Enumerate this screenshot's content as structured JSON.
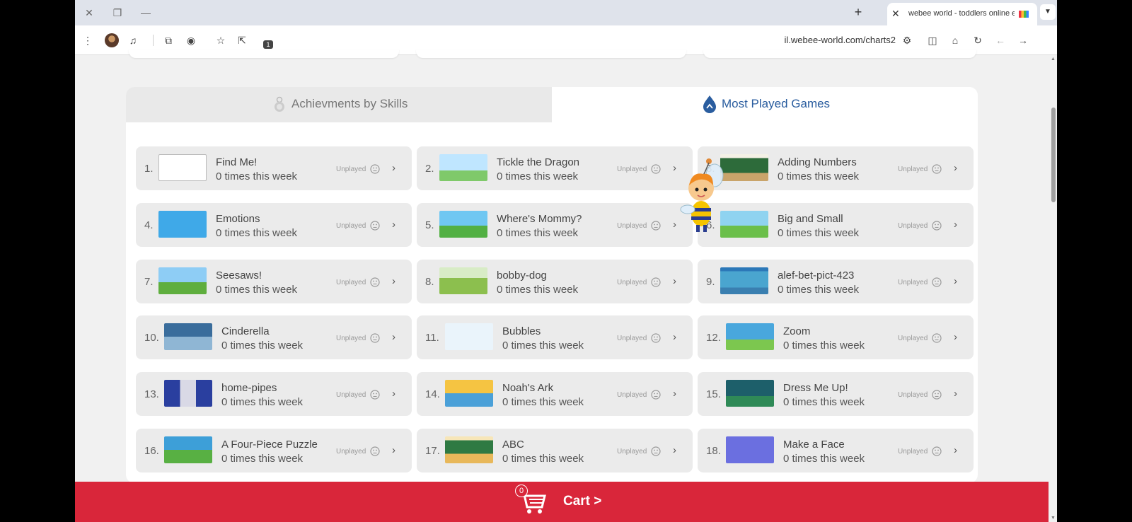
{
  "browser": {
    "tab_title": "webee world - toddlers online e",
    "url": "il.webee-world.com/charts2",
    "extensions_badge": "1"
  },
  "tabs": {
    "skills_label": "Achievments by Skills",
    "played_label": "Most Played Games"
  },
  "games": [
    {
      "rank": "1.",
      "name": "Find Me!",
      "times": "0 times this week",
      "status": "Unplayed"
    },
    {
      "rank": "2.",
      "name": "Tickle the Dragon",
      "times": "0 times this week",
      "status": "Unplayed"
    },
    {
      "rank": "3.",
      "name": "Adding Numbers",
      "times": "0 times this week",
      "status": "Unplayed"
    },
    {
      "rank": "4.",
      "name": "Emotions",
      "times": "0 times this week",
      "status": "Unplayed"
    },
    {
      "rank": "5.",
      "name": "Where's Mommy?",
      "times": "0 times this week",
      "status": "Unplayed"
    },
    {
      "rank": "6.",
      "name": "Big and Small",
      "times": "0 times this week",
      "status": "Unplayed"
    },
    {
      "rank": "7.",
      "name": "Seesaws!",
      "times": "0 times this week",
      "status": "Unplayed"
    },
    {
      "rank": "8.",
      "name": "bobby-dog",
      "times": "0 times this week",
      "status": "Unplayed"
    },
    {
      "rank": "9.",
      "name": "alef-bet-pict-423",
      "times": "0 times this week",
      "status": "Unplayed"
    },
    {
      "rank": "10.",
      "name": "Cinderella",
      "times": "0 times this week",
      "status": "Unplayed"
    },
    {
      "rank": "11.",
      "name": "Bubbles",
      "times": "0 times this week",
      "status": "Unplayed"
    },
    {
      "rank": "12.",
      "name": "Zoom",
      "times": "0 times this week",
      "status": "Unplayed"
    },
    {
      "rank": "13.",
      "name": "home-pipes",
      "times": "0 times this week",
      "status": "Unplayed"
    },
    {
      "rank": "14.",
      "name": "Noah's Ark",
      "times": "0 times this week",
      "status": "Unplayed"
    },
    {
      "rank": "15.",
      "name": "Dress Me Up!",
      "times": "0 times this week",
      "status": "Unplayed"
    },
    {
      "rank": "16.",
      "name": "A Four-Piece Puzzle",
      "times": "0 times this week",
      "status": "Unplayed"
    },
    {
      "rank": "17.",
      "name": "ABC",
      "times": "0 times this week",
      "status": "Unplayed"
    },
    {
      "rank": "18.",
      "name": "Make a Face",
      "times": "0 times this week",
      "status": "Unplayed"
    }
  ],
  "cart": {
    "count": "0",
    "label": "Cart >"
  },
  "colors": {
    "accent_blue": "#2a5d9f",
    "cart_red": "#d9263a"
  }
}
